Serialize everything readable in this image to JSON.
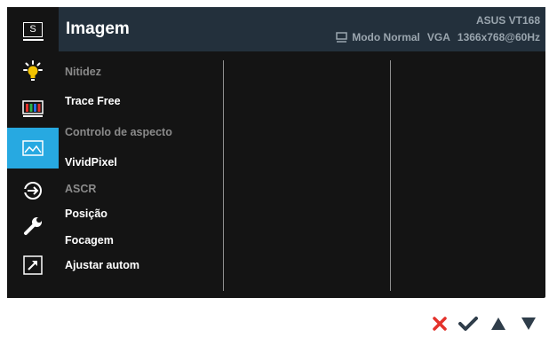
{
  "header": {
    "title": "Imagem",
    "model": "ASUS VT168",
    "mode": "Modo Normal",
    "input": "VGA",
    "resolution": "1366x768@60Hz"
  },
  "sidebar": {
    "items": [
      {
        "name": "splendid",
        "label": "S",
        "icon": "splendid-icon"
      },
      {
        "name": "color",
        "icon": "bulb-icon"
      },
      {
        "name": "color-bars",
        "icon": "color-bars-icon"
      },
      {
        "name": "image",
        "icon": "image-icon",
        "active": true
      },
      {
        "name": "input-select",
        "icon": "input-select-icon"
      },
      {
        "name": "system-setup",
        "icon": "wrench-icon"
      },
      {
        "name": "shortcut",
        "icon": "shortcut-arrow-icon"
      }
    ]
  },
  "menu": {
    "items": [
      {
        "label": "Nitidez",
        "enabled": false
      },
      {
        "label": "Trace Free",
        "enabled": true
      },
      {
        "label": "Controlo de aspecto",
        "enabled": false
      },
      {
        "label": "VividPixel",
        "enabled": true
      },
      {
        "label": "ASCR",
        "enabled": false
      },
      {
        "label": "Posição",
        "enabled": true
      },
      {
        "label": "Focagem",
        "enabled": true
      },
      {
        "label": "Ajustar autom",
        "enabled": true
      }
    ]
  },
  "buttons": [
    {
      "name": "close",
      "icon": "close-icon"
    },
    {
      "name": "confirm",
      "icon": "check-icon"
    },
    {
      "name": "up",
      "icon": "triangle-up-icon"
    },
    {
      "name": "down",
      "icon": "triangle-down-icon"
    }
  ],
  "colors": {
    "accent": "#27a9e1",
    "panel": "#141414",
    "header": "#23303c",
    "close": "#e4322b"
  }
}
